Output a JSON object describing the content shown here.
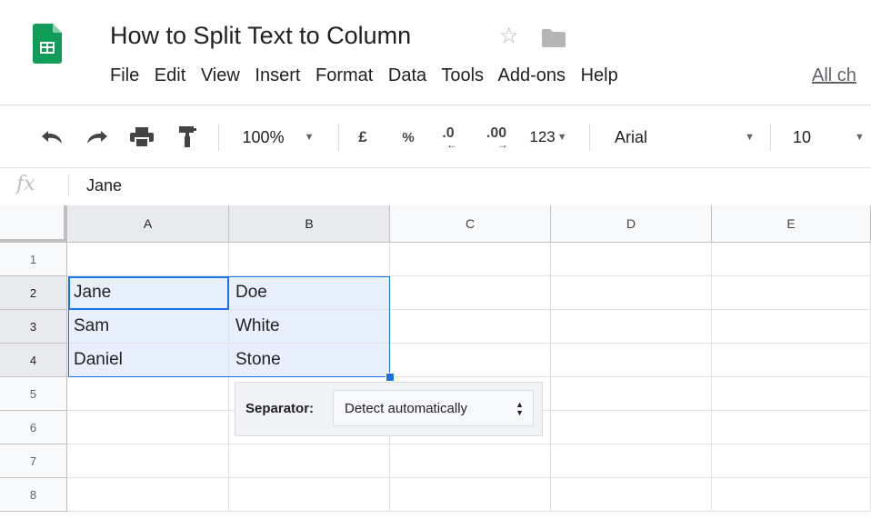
{
  "app": {
    "title": "How to Split Text to Column",
    "icons": {
      "logo": "sheets-logo-icon",
      "star": "star-icon",
      "folder": "folder-icon"
    }
  },
  "menu": {
    "items": [
      "File",
      "Edit",
      "View",
      "Insert",
      "Format",
      "Data",
      "Tools",
      "Add-ons",
      "Help"
    ],
    "all_changes": "All ch"
  },
  "toolbar": {
    "zoom": "100%",
    "currency": "£",
    "percent": "%",
    "decrease_decimal": ".0",
    "increase_decimal": ".00",
    "more_formats": "123",
    "font": "Arial",
    "font_size": "10"
  },
  "formula_bar": {
    "fx": "fx",
    "value": "Jane"
  },
  "grid": {
    "columns": [
      "A",
      "B",
      "C",
      "D",
      "E"
    ],
    "rows": [
      "1",
      "2",
      "3",
      "4",
      "5",
      "6",
      "7",
      "8"
    ],
    "cells": {
      "A2": "Jane",
      "B2": "Doe",
      "A3": "Sam",
      "B3": "White",
      "A4": "Daniel",
      "B4": "Stone"
    }
  },
  "separator": {
    "label": "Separator:",
    "value": "Detect automatically"
  },
  "colors": {
    "accent": "#1a73e8",
    "sheets_green": "#0f9d58",
    "selection_fill": "#e8f0fe"
  }
}
